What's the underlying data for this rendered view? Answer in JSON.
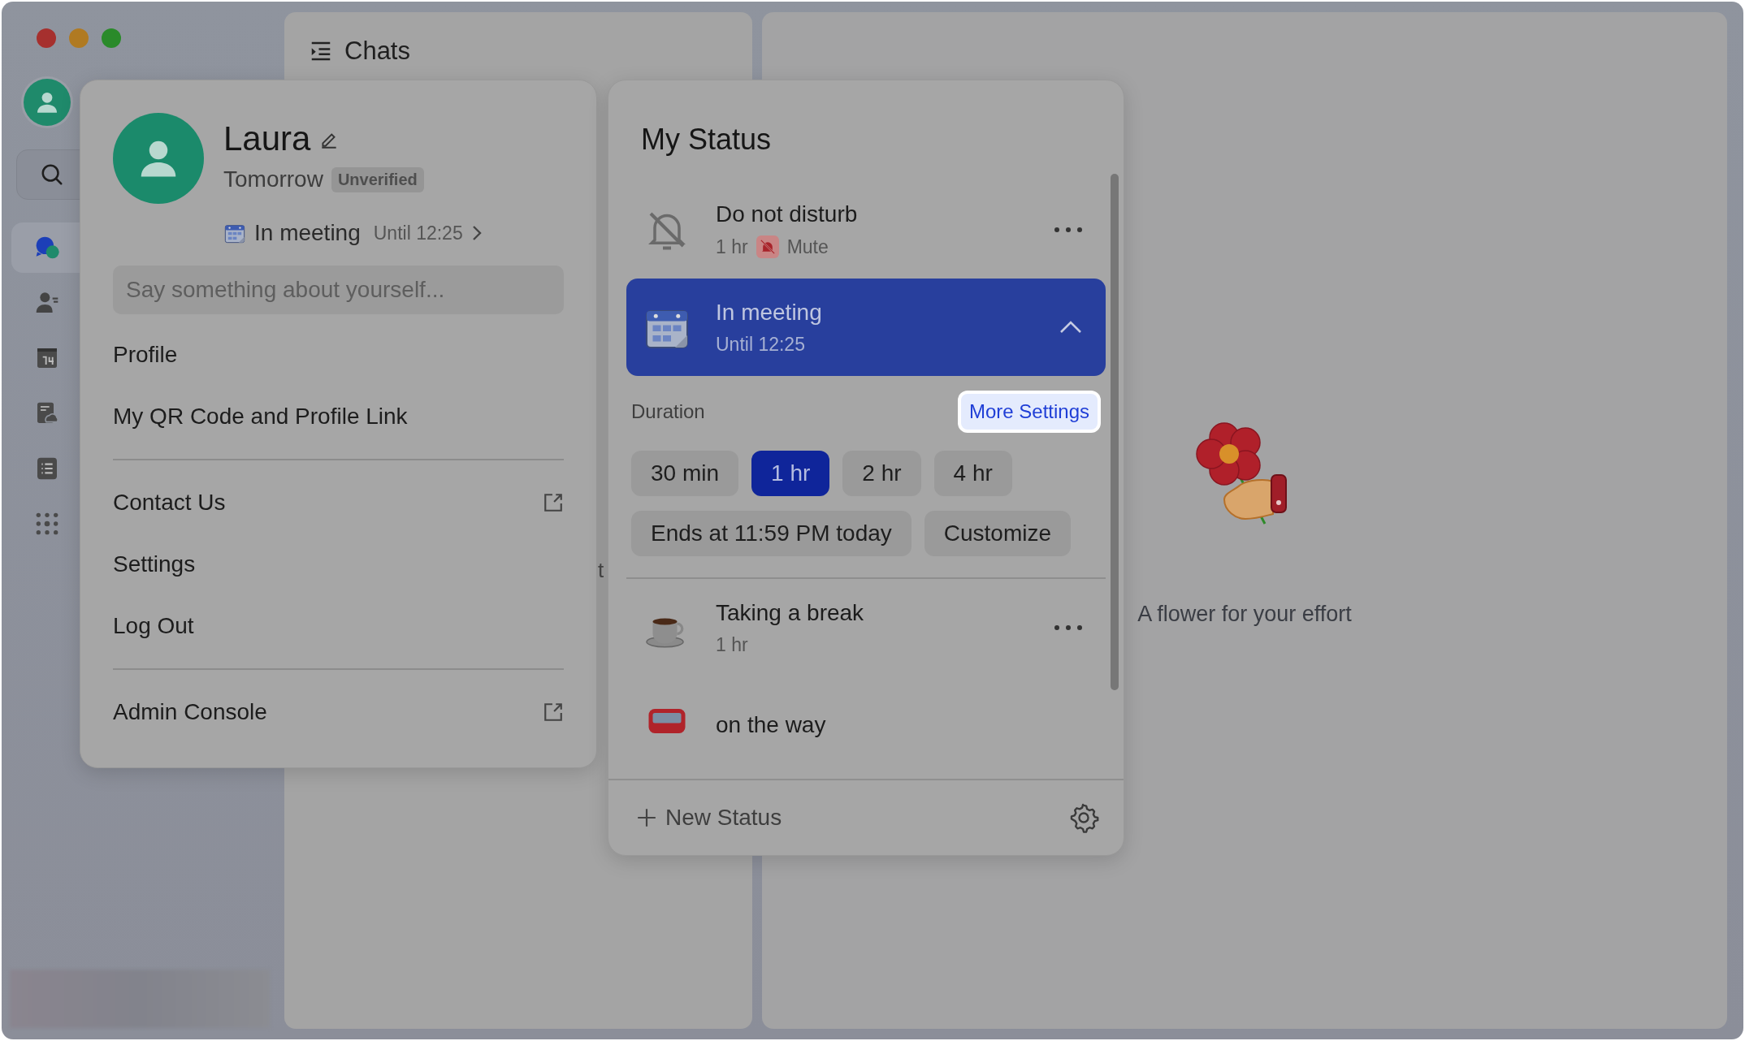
{
  "sidebar": {
    "nav_items": [
      {
        "kind": "chat",
        "selected": true
      },
      {
        "kind": "contacts",
        "selected": false
      },
      {
        "kind": "calendar",
        "selected": false
      },
      {
        "kind": "docs",
        "selected": false
      },
      {
        "kind": "list",
        "selected": false
      },
      {
        "kind": "apps",
        "selected": false
      }
    ]
  },
  "chats_panel": {
    "title": "Chats",
    "fragment": "t"
  },
  "main_panel": {
    "caption": "A flower for your effort"
  },
  "profile_menu": {
    "name": "Laura",
    "organization": "Tomorrow",
    "badge": "Unverified",
    "status": {
      "label": "In meeting",
      "until": "Until 12:25"
    },
    "bio_placeholder": "Say something about yourself...",
    "groups": [
      {
        "items": [
          {
            "label": "Profile",
            "external": false
          },
          {
            "label": "My QR Code and Profile Link",
            "external": false
          }
        ]
      },
      {
        "items": [
          {
            "label": "Contact Us",
            "external": true
          },
          {
            "label": "Settings",
            "external": false
          },
          {
            "label": "Log Out",
            "external": false
          }
        ]
      },
      {
        "items": [
          {
            "label": "Admin Console",
            "external": true
          }
        ]
      }
    ]
  },
  "status_panel": {
    "title": "My Status",
    "statuses": [
      {
        "kind": "dnd",
        "title": "Do not disturb",
        "duration": "1 hr",
        "badge": "Mute",
        "selected": false,
        "expanded": false
      },
      {
        "kind": "meeting",
        "title": "In meeting",
        "duration": "Until 12:25",
        "selected": true,
        "expanded": true
      },
      {
        "kind": "break",
        "title": "Taking a break",
        "duration": "1 hr",
        "selected": false,
        "expanded": false
      },
      {
        "kind": "travel",
        "title": "on the way",
        "selected": false,
        "expanded": false
      }
    ],
    "duration_label": "Duration",
    "more_settings": "More Settings",
    "duration_options": [
      {
        "label": "30 min",
        "selected": false
      },
      {
        "label": "1 hr",
        "selected": true
      },
      {
        "label": "2 hr",
        "selected": false
      },
      {
        "label": "4 hr",
        "selected": false
      },
      {
        "label": "Ends at 11:59 PM today",
        "selected": false
      },
      {
        "label": "Customize",
        "selected": false
      }
    ],
    "new_status": "New Status"
  }
}
